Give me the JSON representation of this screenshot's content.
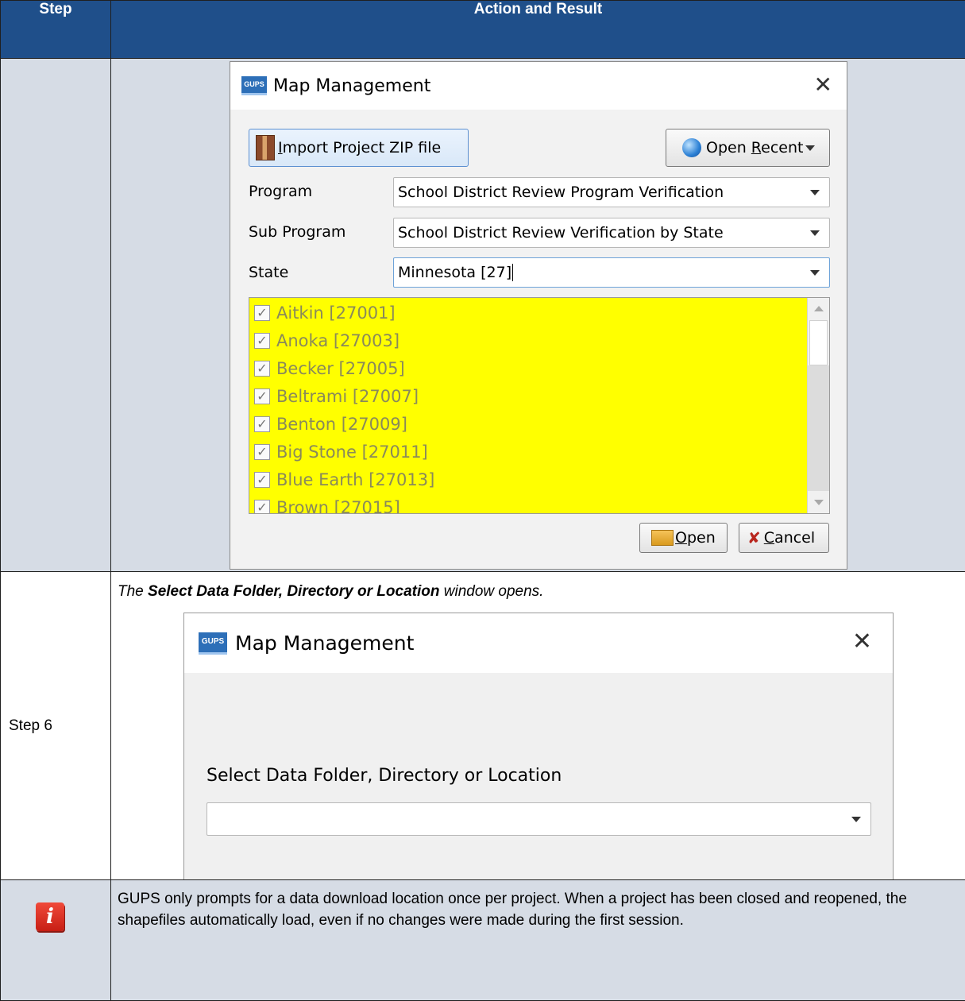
{
  "header": {
    "step": "Step",
    "action": "Action and Result"
  },
  "row1": {
    "dialog": {
      "title": "Map Management",
      "logo": "GUPS",
      "import_button": {
        "pre": "",
        "mnemonic": "I",
        "post": "mport Project ZIP file"
      },
      "open_recent_button": {
        "pre": "Open ",
        "mnemonic": "R",
        "post": "ecent"
      },
      "program_label": "Program",
      "program_value": "School District Review Program Verification",
      "subprogram_label": "Sub Program",
      "subprogram_value": "School District Review Verification by State",
      "state_label": "State",
      "state_value": "Minnesota [27]",
      "counties": [
        "Aitkin [27001]",
        "Anoka [27003]",
        "Becker [27005]",
        "Beltrami [27007]",
        "Benton [27009]",
        "Big Stone [27011]",
        "Blue Earth [27013]",
        "Brown [27015]"
      ],
      "open_button": {
        "mnemonic": "O",
        "post": "pen"
      },
      "cancel_button": {
        "mnemonic": "C",
        "post": "ancel"
      },
      "highlight_color": "#ffff00"
    }
  },
  "row2": {
    "step": "Step 6",
    "caption_pre": "The ",
    "caption_bold": "Select Data Folder, Directory or Location",
    "caption_post": " window opens.",
    "dialog": {
      "title": "Map Management",
      "logo": "GUPS",
      "label": "Select Data Folder, Directory or Location",
      "value": ""
    }
  },
  "note": {
    "icon": "info-icon",
    "text": "GUPS only prompts for a data download location once per project. When a project has been closed and reopened, the shapefiles automatically load, even if no changes were made during the first session."
  }
}
